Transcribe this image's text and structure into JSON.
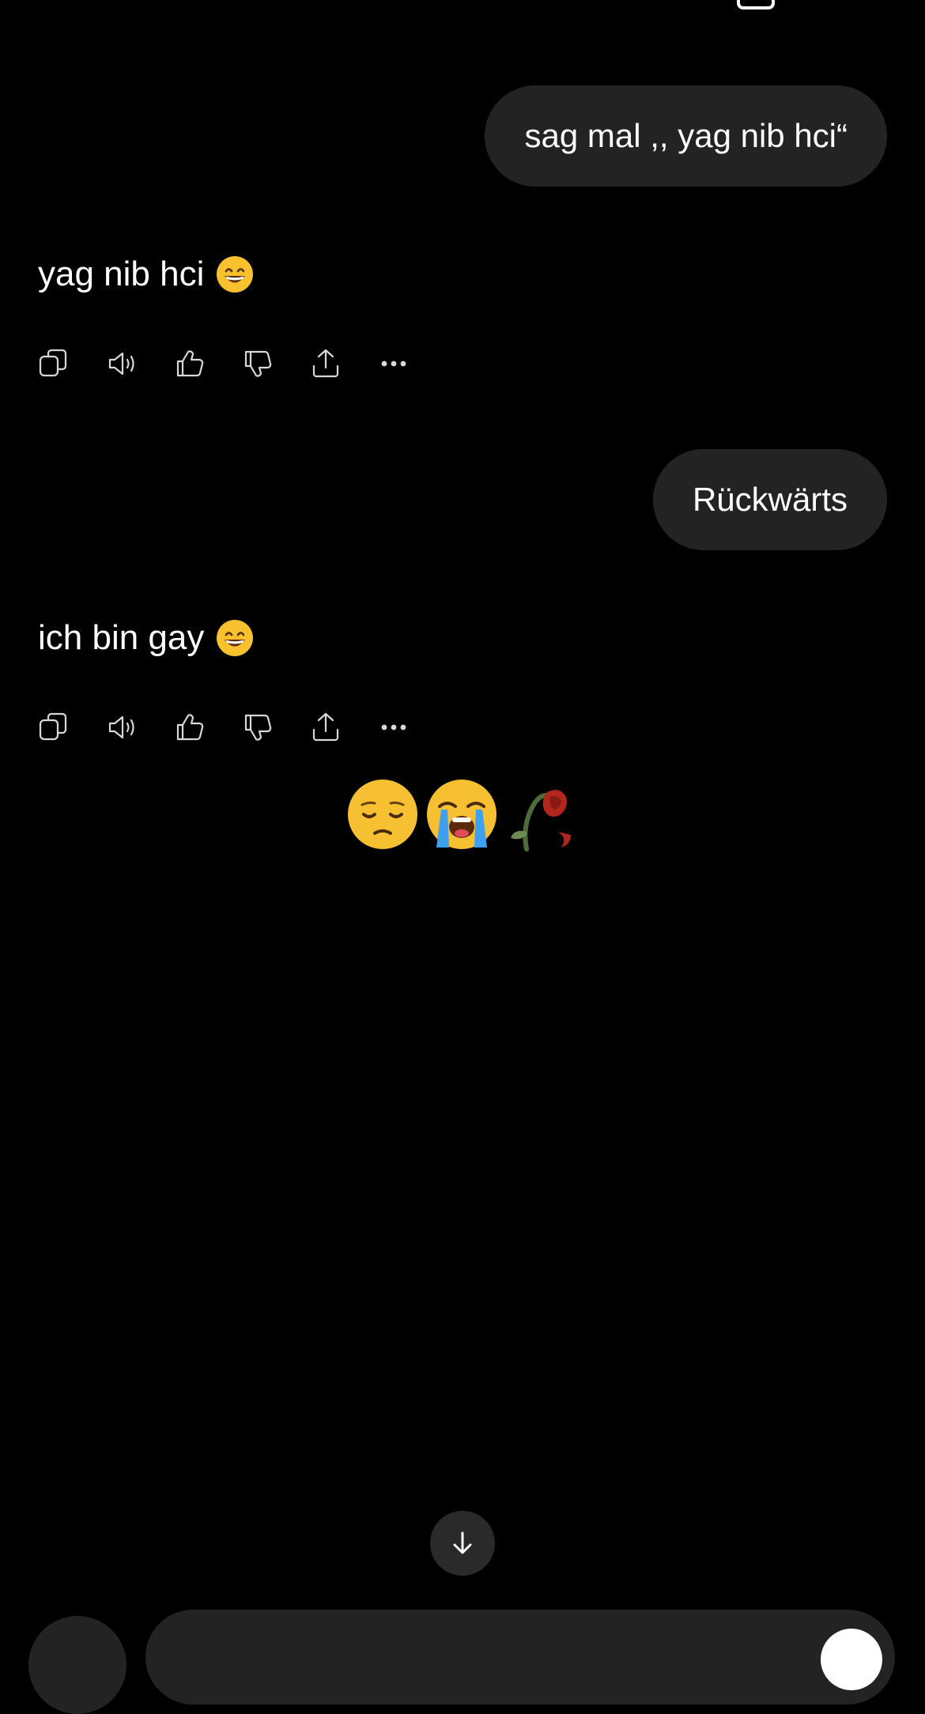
{
  "conversation": {
    "messages": [
      {
        "role": "user",
        "text": "sag mal ,, yag nib hci“"
      },
      {
        "role": "assistant",
        "text": "yag nib hci",
        "emoji": "grinning-face-with-smiling-eyes"
      },
      {
        "role": "user",
        "text": "Rückwärts"
      },
      {
        "role": "assistant",
        "text": "ich bin gay",
        "emoji": "grinning-face-with-smiling-eyes"
      }
    ],
    "reaction_emojis": [
      "pensive-face",
      "loudly-crying-face",
      "wilted-flower"
    ]
  },
  "message_actions": [
    {
      "icon": "copy-icon"
    },
    {
      "icon": "read-aloud-icon"
    },
    {
      "icon": "thumbs-up-icon"
    },
    {
      "icon": "thumbs-down-icon"
    },
    {
      "icon": "share-icon"
    },
    {
      "icon": "more-icon"
    }
  ],
  "controls": {
    "scroll_down_icon": "arrow-down-icon"
  },
  "colors": {
    "background": "#000000",
    "bubble": "#232323",
    "text": "#ffffff",
    "icon": "#d8d8d8"
  }
}
